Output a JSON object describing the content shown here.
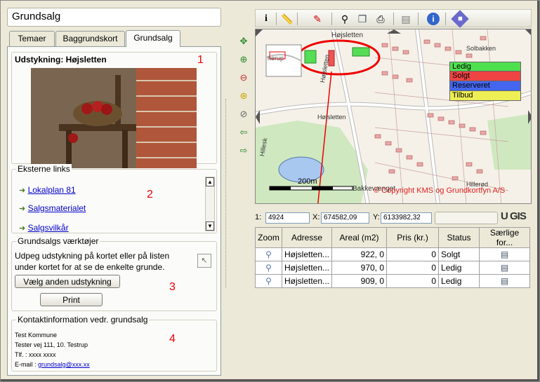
{
  "title": "Grundsalg",
  "tabs": [
    "Temaer",
    "Baggrundskort",
    "Grundsalg"
  ],
  "subdivision": {
    "label": "Udstykning: Højsletten"
  },
  "external_links": {
    "legend": "Eksterne links",
    "items": [
      "Lokalplan 81",
      "Salgsmaterialet",
      "Salgsvilkår"
    ]
  },
  "tools": {
    "legend": "Grundsalgs værktøjer",
    "text": "Udpeg udstykning på kortet eller på listen under kortet for at se de enkelte grunde.",
    "choose_button": "Vælg anden udstykning",
    "print_button": "Print"
  },
  "contact": {
    "legend": "Kontaktinformation vedr. grundsalg",
    "name": "Test Kommune",
    "address": "Tester vej 111, 10. Testrup",
    "phone": "Tlf. : xxxx xxxx",
    "email_label": "E-mail :",
    "email": "grundsalg@xxx.xx"
  },
  "annotations": [
    "1",
    "2",
    "3",
    "4"
  ],
  "map": {
    "legend": [
      "Ledig",
      "Solgt",
      "Reserveret",
      "Tilbud"
    ],
    "legend_colors": [
      "#4fe04f",
      "#ee4444",
      "#4466ee",
      "#eeee55"
    ],
    "scale": "200m",
    "copyright": "© Copyright KMS og Grundkortfyn A/S",
    "labels": [
      "Højsletten",
      "Højsletten",
      "Højsletten",
      "Bakkevænget",
      "Hillerød",
      "Hillesk",
      "Solbakken"
    ]
  },
  "coords": {
    "scale_label": "1:",
    "scale": "4924",
    "x_label": "X:",
    "x": "674582,09",
    "y_label": "Y:",
    "y": "6133982,32",
    "logo": "U GIS"
  },
  "table": {
    "headers": [
      "Zoom",
      "Adresse",
      "Areal (m2)",
      "Pris (kr.)",
      "Status",
      "Særlige for..."
    ],
    "rows": [
      {
        "address": "Højsletten...",
        "area": "922, 0",
        "price": "0",
        "status": "Solgt"
      },
      {
        "address": "Højsletten...",
        "area": "970, 0",
        "price": "0",
        "status": "Ledig"
      },
      {
        "address": "Højsletten...",
        "area": "909, 0",
        "price": "0",
        "status": "Ledig"
      }
    ]
  },
  "colors": {
    "annotation_red": "#e00000",
    "link_blue": "#0000cc"
  }
}
